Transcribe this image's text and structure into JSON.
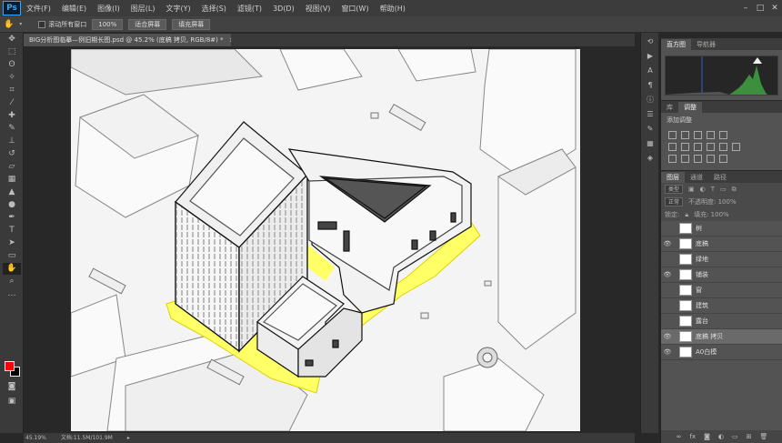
{
  "app": {
    "logo": "Ps",
    "colors": {
      "accent": "#31a8ff",
      "highlight": "#ffff66"
    }
  },
  "menu": [
    "文件(F)",
    "编辑(E)",
    "图像(I)",
    "图层(L)",
    "文字(Y)",
    "选择(S)",
    "滤镜(T)",
    "3D(D)",
    "视图(V)",
    "窗口(W)",
    "帮助(H)"
  ],
  "options": {
    "scroll_all": "滚动所有窗口",
    "zoom": "100%",
    "fit": "适合屏幕",
    "fill": "填充屏幕"
  },
  "document": {
    "tab": "BIG分析图临摹—例旧期长图.psd @ 45.2% (底稿 拷贝, RGB/8#) *",
    "close": "×"
  },
  "status": {
    "zoom": "45.19%",
    "doc": "文档:11.5M/101.9M"
  },
  "histogram": {
    "tabs": [
      "直方图",
      "导航器"
    ]
  },
  "adjustments": {
    "tabs": [
      "库",
      "调整"
    ],
    "add": "添加调整"
  },
  "layers": {
    "tabs": [
      "图层",
      "通道",
      "路径"
    ],
    "filter_kind": "类型",
    "blend_mode": "正常",
    "opacity": "不透明度: 100%",
    "lock": "锁定:",
    "fill": "填充: 100%",
    "items": [
      {
        "name": "树",
        "visible": false
      },
      {
        "name": "底稿",
        "visible": true
      },
      {
        "name": "绿地",
        "visible": false
      },
      {
        "name": "铺装",
        "visible": true
      },
      {
        "name": "窗",
        "visible": false
      },
      {
        "name": "建筑",
        "visible": false
      },
      {
        "name": "露台",
        "visible": false
      },
      {
        "name": "底稿 拷贝",
        "visible": true,
        "selected": true
      },
      {
        "name": "A0白模",
        "visible": true
      }
    ]
  }
}
